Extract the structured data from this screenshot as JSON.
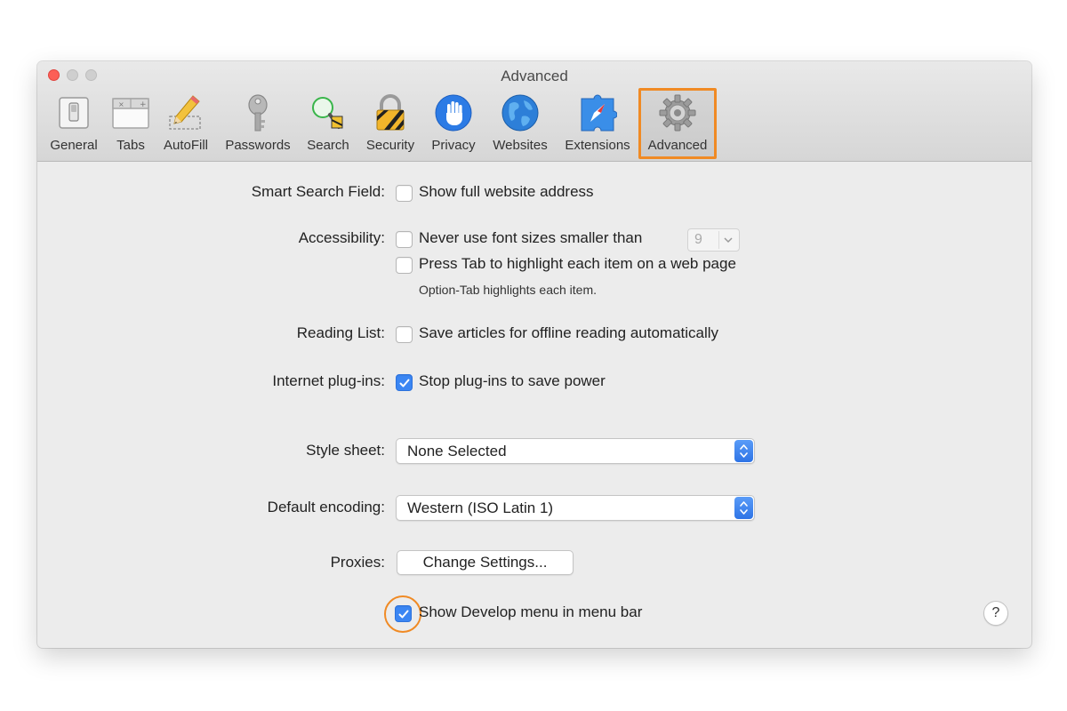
{
  "window": {
    "title": "Advanced"
  },
  "toolbar": {
    "items": [
      {
        "label": "General",
        "icon": "general-switch-icon"
      },
      {
        "label": "Tabs",
        "icon": "tabs-icon"
      },
      {
        "label": "AutoFill",
        "icon": "pencil-icon"
      },
      {
        "label": "Passwords",
        "icon": "key-icon"
      },
      {
        "label": "Search",
        "icon": "magnifier-icon"
      },
      {
        "label": "Security",
        "icon": "padlock-icon"
      },
      {
        "label": "Privacy",
        "icon": "hand-icon"
      },
      {
        "label": "Websites",
        "icon": "globe-icon"
      },
      {
        "label": "Extensions",
        "icon": "puzzle-compass-icon"
      },
      {
        "label": "Advanced",
        "icon": "gear-icon"
      }
    ],
    "selected": "Advanced"
  },
  "settings": {
    "smart_search": {
      "label": "Smart Search Field:",
      "option": "Show full website address",
      "checked": false
    },
    "accessibility": {
      "label": "Accessibility:",
      "option1": "Never use font sizes smaller than",
      "option1_checked": false,
      "font_size": "9",
      "option2": "Press Tab to highlight each item on a web page",
      "option2_checked": false,
      "hint": "Option-Tab highlights each item."
    },
    "reading_list": {
      "label": "Reading List:",
      "option": "Save articles for offline reading automatically",
      "checked": false
    },
    "plugins": {
      "label": "Internet plug-ins:",
      "option": "Stop plug-ins to save power",
      "checked": true
    },
    "style_sheet": {
      "label": "Style sheet:",
      "value": "None Selected"
    },
    "encoding": {
      "label": "Default encoding:",
      "value": "Western (ISO Latin 1)"
    },
    "proxies": {
      "label": "Proxies:",
      "button": "Change Settings..."
    },
    "develop": {
      "option": "Show Develop menu in menu bar",
      "checked": true
    },
    "help": "?"
  },
  "colors": {
    "accent_highlight": "#f08a24",
    "checkbox_checked": "#3b86f3",
    "window_bg": "#ececec"
  }
}
